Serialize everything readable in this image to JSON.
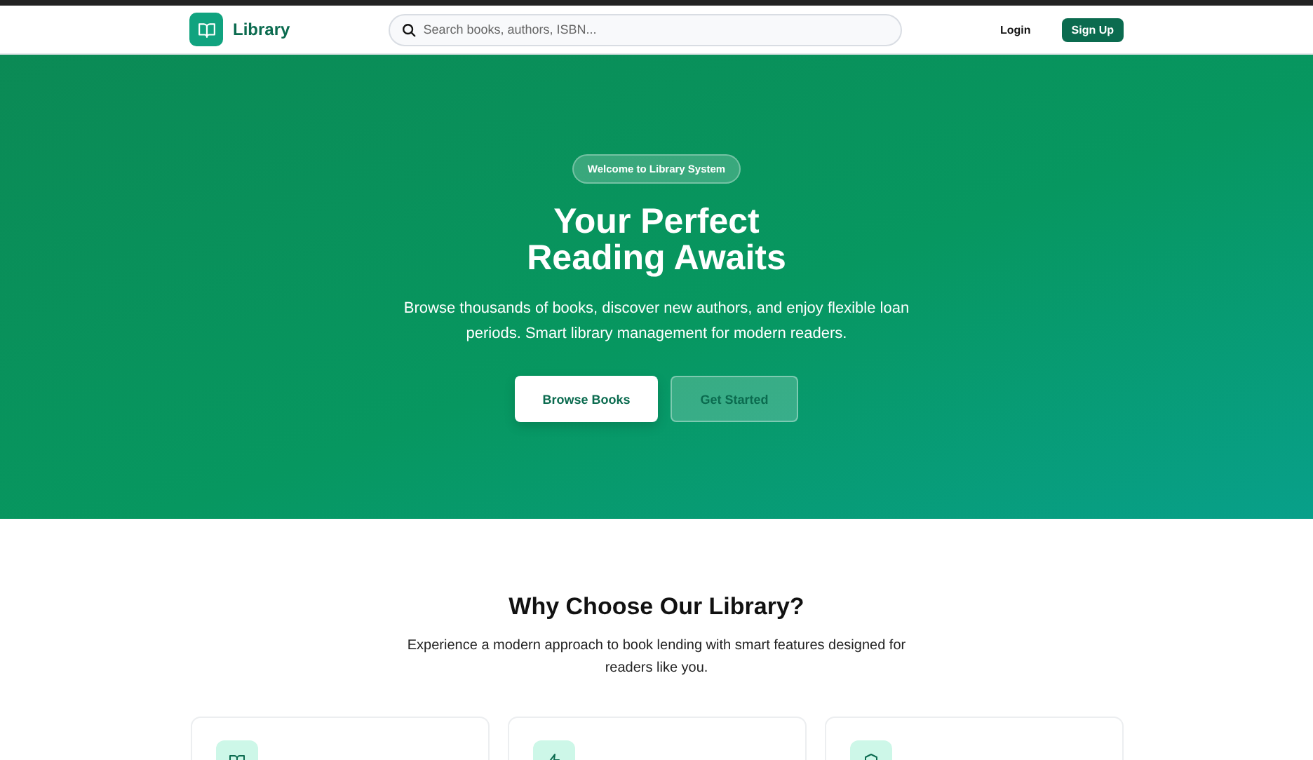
{
  "header": {
    "brand": "Library",
    "search": {
      "placeholder": "Search books, authors, ISBN..."
    },
    "login": "Login",
    "signup": "Sign Up"
  },
  "hero": {
    "badge": "Welcome to Library System",
    "title_lines": [
      "Your Perfect",
      "Reading Awaits"
    ],
    "description": "Browse thousands of books, discover new authors, and enjoy flexible loan periods. Smart library management for modern readers.",
    "buttons": [
      {
        "label": "Browse Books",
        "kind": "primary"
      },
      {
        "label": "Get Started",
        "kind": "secondary"
      }
    ]
  },
  "features": {
    "title": "Why Choose Our Library?",
    "subtitle": "Experience a modern approach to book lending with smart features designed for readers like you."
  }
}
